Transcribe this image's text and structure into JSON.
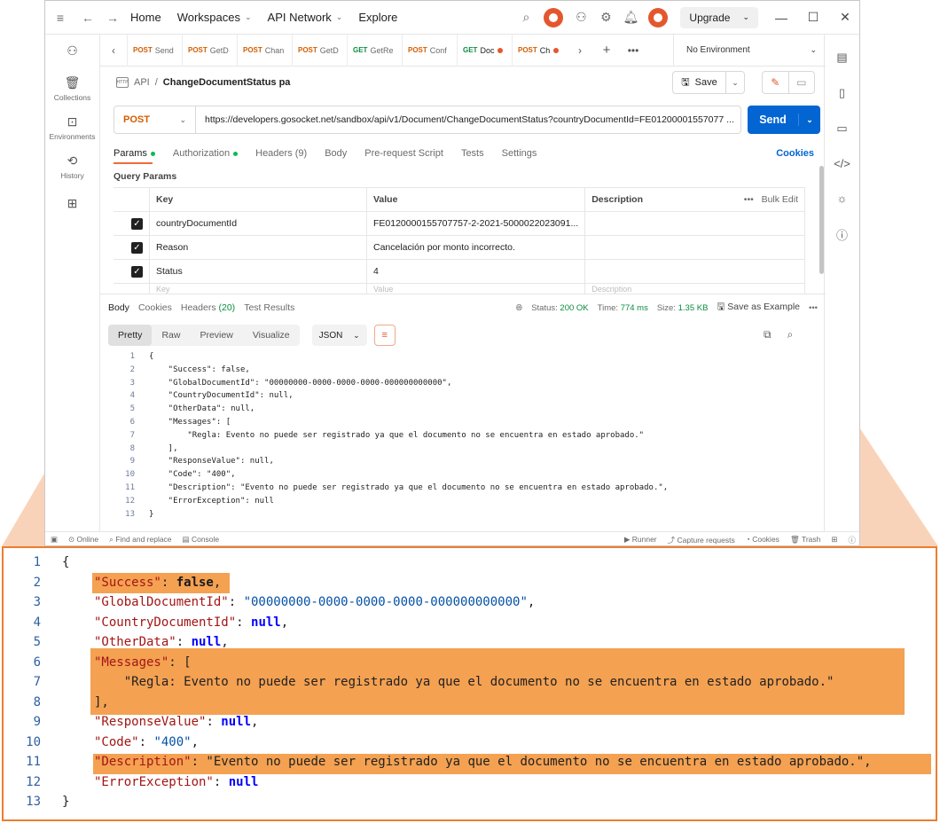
{
  "topbar": {
    "home": "Home",
    "workspaces": "Workspaces",
    "api_network": "API Network",
    "explore": "Explore",
    "upgrade": "Upgrade"
  },
  "leftbar": {
    "collections": "Collections",
    "environments": "Environments",
    "history": "History"
  },
  "tabs": [
    {
      "method": "POST",
      "label": "Send"
    },
    {
      "method": "POST",
      "label": "GetD"
    },
    {
      "method": "POST",
      "label": "Chan"
    },
    {
      "method": "POST",
      "label": "GetD"
    },
    {
      "method": "GET",
      "label": "GetRe"
    },
    {
      "method": "POST",
      "label": "Conf"
    },
    {
      "method": "GET",
      "label": "Doc"
    },
    {
      "method": "POST",
      "label": "Ch"
    }
  ],
  "environment": "No Environment",
  "breadcrumb": {
    "root": "API",
    "current": "ChangeDocumentStatus pa"
  },
  "save_label": "Save",
  "request": {
    "method": "POST",
    "url": "https://developers.gosocket.net/sandbox/api/v1/Document/ChangeDocumentStatus?countryDocumentId=FE01200001557077 ...",
    "send": "Send"
  },
  "request_tabs": {
    "params": "Params",
    "authorization": "Authorization",
    "headers": "Headers (9)",
    "body": "Body",
    "prerequest": "Pre-request Script",
    "tests": "Tests",
    "settings": "Settings",
    "cookies": "Cookies"
  },
  "query_params": {
    "title": "Query Params",
    "headers": {
      "key": "Key",
      "value": "Value",
      "description": "Description",
      "bulk": "Bulk Edit"
    },
    "rows": [
      {
        "key": "countryDocumentId",
        "value": "FE0120000155707757-2-2021-5000022023091..."
      },
      {
        "key": "Reason",
        "value": "Cancelación por monto incorrecto."
      },
      {
        "key": "Status",
        "value": "4"
      }
    ],
    "placeholder": {
      "key": "Key",
      "value": "Value",
      "description": "Description"
    }
  },
  "response_tabs": {
    "body": "Body",
    "cookies": "Cookies",
    "headers_label": "Headers",
    "headers_count": "(20)",
    "test_results": "Test Results",
    "status_label": "Status:",
    "status_value": "200 OK",
    "time_label": "Time:",
    "time_value": "774 ms",
    "size_label": "Size:",
    "size_value": "1.35 KB",
    "save_example": "Save as Example"
  },
  "format": {
    "pretty": "Pretty",
    "raw": "Raw",
    "preview": "Preview",
    "visualize": "Visualize",
    "json": "JSON"
  },
  "code_lines": [
    "{",
    "    \"Success\": false,",
    "    \"GlobalDocumentId\": \"00000000-0000-0000-0000-000000000000\",",
    "    \"CountryDocumentId\": null,",
    "    \"OtherData\": null,",
    "    \"Messages\": [",
    "        \"Regla: Evento no puede ser registrado ya que el documento no se encuentra en estado aprobado.\"",
    "    ],",
    "    \"ResponseValue\": null,",
    "    \"Code\": \"400\",",
    "    \"Description\": \"Evento no puede ser registrado ya que el documento no se encuentra en estado aprobado.\",",
    "    \"ErrorException\": null",
    "}"
  ],
  "zoom_lines": [
    {
      "n": "1",
      "parts": [
        [
          "p",
          "{"
        ]
      ]
    },
    {
      "n": "2",
      "parts": [
        [
          "k",
          "\"Success\""
        ],
        [
          "p",
          ": "
        ],
        [
          "kwb",
          "false"
        ],
        [
          "p",
          ","
        ]
      ]
    },
    {
      "n": "3",
      "parts": [
        [
          "k",
          "\"GlobalDocumentId\""
        ],
        [
          "p",
          ": "
        ],
        [
          "s",
          "\"00000000-0000-0000-0000-000000000000\""
        ],
        [
          "p",
          ","
        ]
      ]
    },
    {
      "n": "4",
      "parts": [
        [
          "k",
          "\"CountryDocumentId\""
        ],
        [
          "p",
          ": "
        ],
        [
          "kw",
          "null"
        ],
        [
          "p",
          ","
        ]
      ]
    },
    {
      "n": "5",
      "parts": [
        [
          "k",
          "\"OtherData\""
        ],
        [
          "p",
          ": "
        ],
        [
          "kw",
          "null"
        ],
        [
          "p",
          ","
        ]
      ]
    },
    {
      "n": "6",
      "parts": [
        [
          "k",
          "\"Messages\""
        ],
        [
          "p",
          ": ["
        ]
      ]
    },
    {
      "n": "7",
      "parts": [
        [
          "p",
          "    \"Regla: Evento no puede ser registrado ya que el documento no se encuentra en estado aprobado.\""
        ]
      ]
    },
    {
      "n": "8",
      "parts": [
        [
          "p",
          "],"
        ]
      ]
    },
    {
      "n": "9",
      "parts": [
        [
          "k",
          "\"ResponseValue\""
        ],
        [
          "p",
          ": "
        ],
        [
          "kw",
          "null"
        ],
        [
          "p",
          ","
        ]
      ]
    },
    {
      "n": "10",
      "parts": [
        [
          "k",
          "\"Code\""
        ],
        [
          "p",
          ": "
        ],
        [
          "s",
          "\"400\""
        ],
        [
          "p",
          ","
        ]
      ]
    },
    {
      "n": "11",
      "parts": [
        [
          "k",
          "\"Description\""
        ],
        [
          "p",
          ": \"Evento no puede ser registrado ya que el documento no se encuentra en estado aprobado.\","
        ]
      ]
    },
    {
      "n": "12",
      "parts": [
        [
          "k",
          "\"ErrorException\""
        ],
        [
          "p",
          ": "
        ],
        [
          "kw",
          "null"
        ]
      ]
    },
    {
      "n": "13",
      "parts": [
        [
          "p",
          "}"
        ]
      ]
    }
  ],
  "statusbar": {
    "online": "Online",
    "find_replace": "Find and replace",
    "console": "Console",
    "runner": "Runner",
    "capture": "Capture requests",
    "cookies": "Cookies",
    "trash": "Trash"
  },
  "colors": {
    "accent": "#ed7d31",
    "highlight": "#f4a152",
    "send": "#0265d2",
    "method_post": "#d35d00"
  }
}
